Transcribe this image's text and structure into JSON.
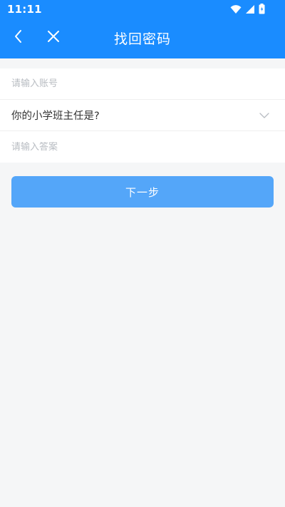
{
  "status_bar": {
    "time": "11:11",
    "icons": [
      "wifi-icon",
      "signal-icon",
      "battery-icon"
    ]
  },
  "header": {
    "title": "找回密码",
    "back_icon": "chevron-left-icon",
    "close_icon": "close-icon",
    "background_color": "#1a8cff"
  },
  "form": {
    "account_placeholder": "请输入账号",
    "account_value": "",
    "security_question": "你的小学班主任是?",
    "answer_placeholder": "请输入答案",
    "answer_value": ""
  },
  "actions": {
    "next_label": "下一步",
    "button_color": "#54a6f9"
  }
}
